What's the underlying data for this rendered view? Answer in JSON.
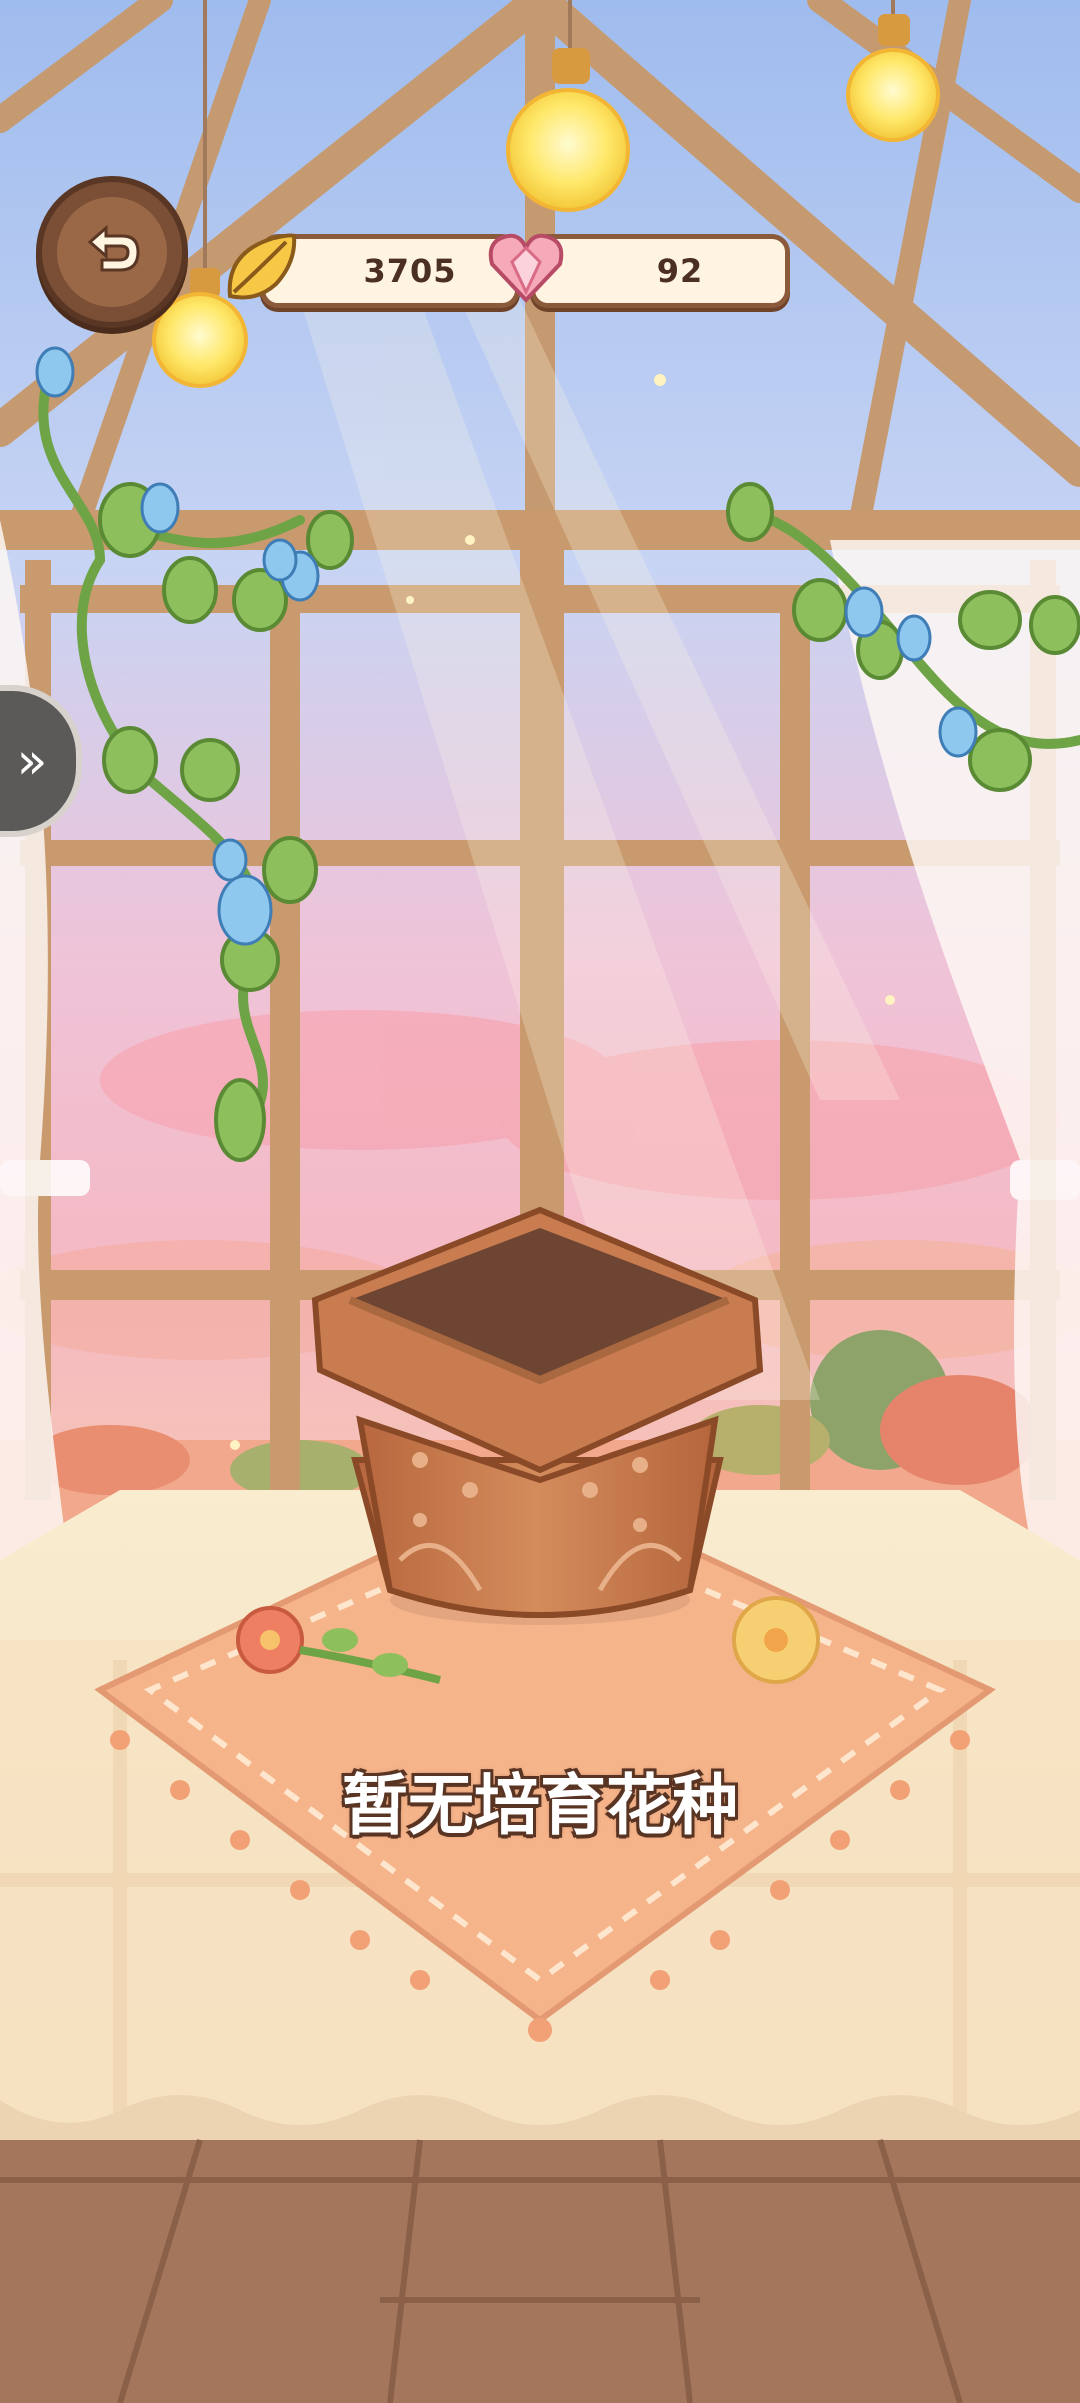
{
  "hud": {
    "back_icon": "undo-arrow-icon",
    "leaf_currency": "3705",
    "heart_currency": "92",
    "side_arrow_icon": "double-chevron-right-icon"
  },
  "main": {
    "status_text": "暂无培育花种"
  },
  "colors": {
    "window_frame": "#c89a6e",
    "sky_top": "#a9c4ee",
    "sky_sunset": "#f2b6c8",
    "pot": "#c97c4f",
    "soil": "#6e4532",
    "tablecloth": "#f6e4c4",
    "mat": "#f6b48a",
    "floor": "#a4775c"
  }
}
